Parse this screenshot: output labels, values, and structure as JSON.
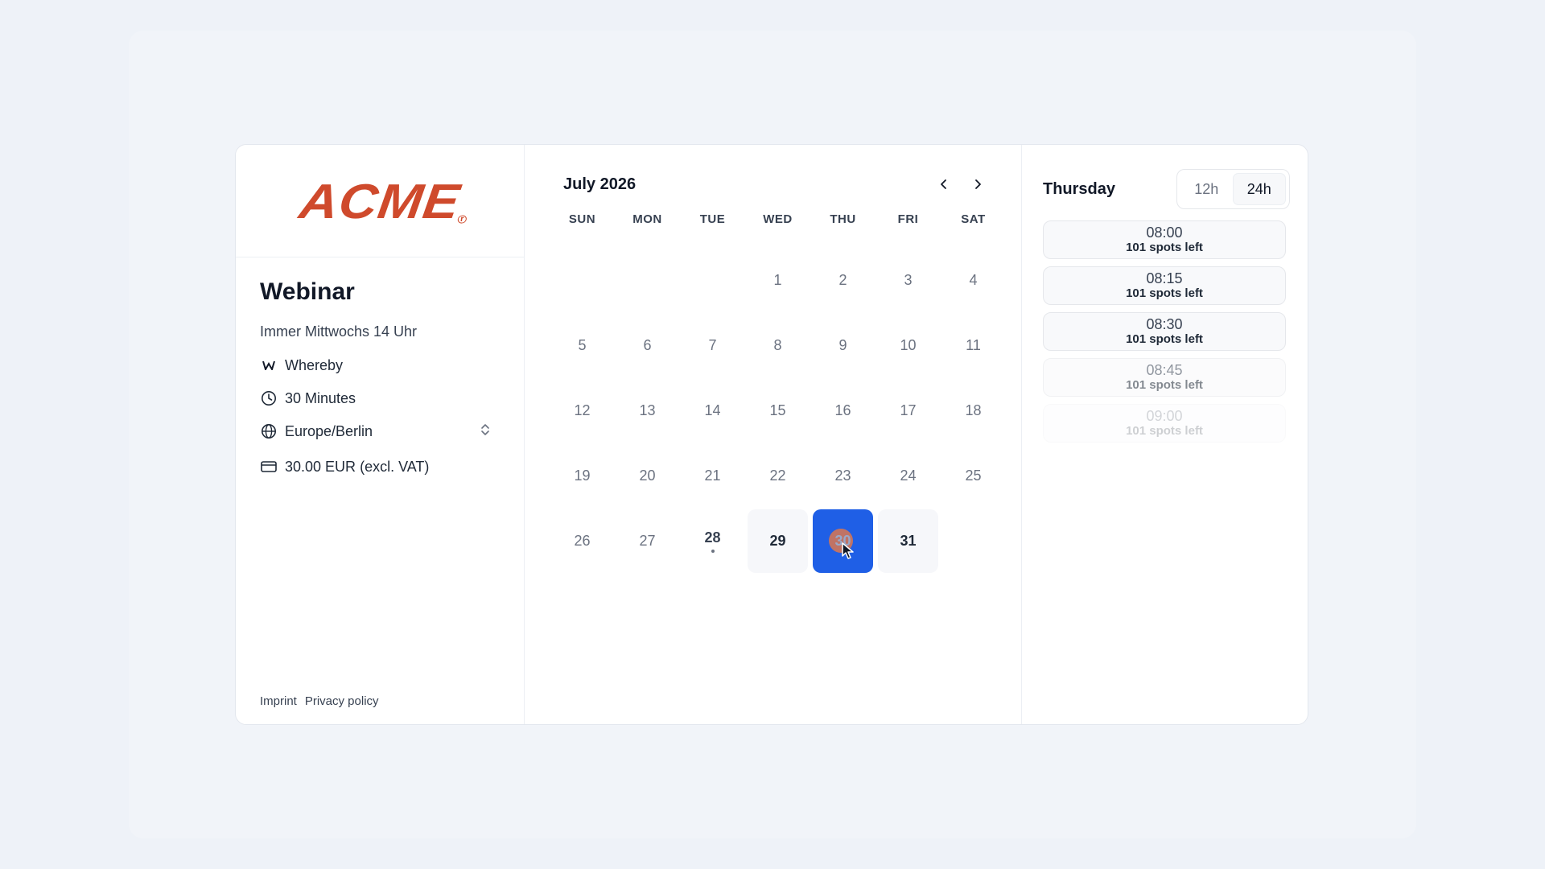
{
  "brand": {
    "logo_text": "ACME",
    "logo_color": "#cf4a2c"
  },
  "event": {
    "title": "Webinar",
    "subtitle": "Immer Mittwochs 14 Uhr",
    "platform": "Whereby",
    "duration": "30 Minutes",
    "timezone": "Europe/Berlin",
    "price": "30.00 EUR",
    "price_note": "(excl. VAT)"
  },
  "footer": {
    "imprint": "Imprint",
    "privacy": "Privacy policy"
  },
  "calendar": {
    "month_label": "July 2026",
    "weekdays": [
      "SUN",
      "MON",
      "TUE",
      "WED",
      "THU",
      "FRI",
      "SAT"
    ],
    "days": [
      "1",
      "2",
      "3",
      "4",
      "5",
      "6",
      "7",
      "8",
      "9",
      "10",
      "11",
      "12",
      "13",
      "14",
      "15",
      "16",
      "17",
      "18",
      "19",
      "20",
      "21",
      "22",
      "23",
      "24",
      "25",
      "26",
      "27",
      "28",
      "29",
      "30",
      "31"
    ],
    "today": "28",
    "selected": "30",
    "available": [
      "29",
      "30",
      "31"
    ],
    "accent_color": "#1f5fe6"
  },
  "times": {
    "weekday": "Thursday",
    "format_12h": "12h",
    "format_24h": "24h",
    "active_format": "24h",
    "slots": [
      {
        "time": "08:00",
        "spots": "101 spots left"
      },
      {
        "time": "08:15",
        "spots": "101 spots left"
      },
      {
        "time": "08:30",
        "spots": "101 spots left"
      },
      {
        "time": "08:45",
        "spots": "101 spots left"
      },
      {
        "time": "09:00",
        "spots": "101 spots left"
      }
    ]
  }
}
